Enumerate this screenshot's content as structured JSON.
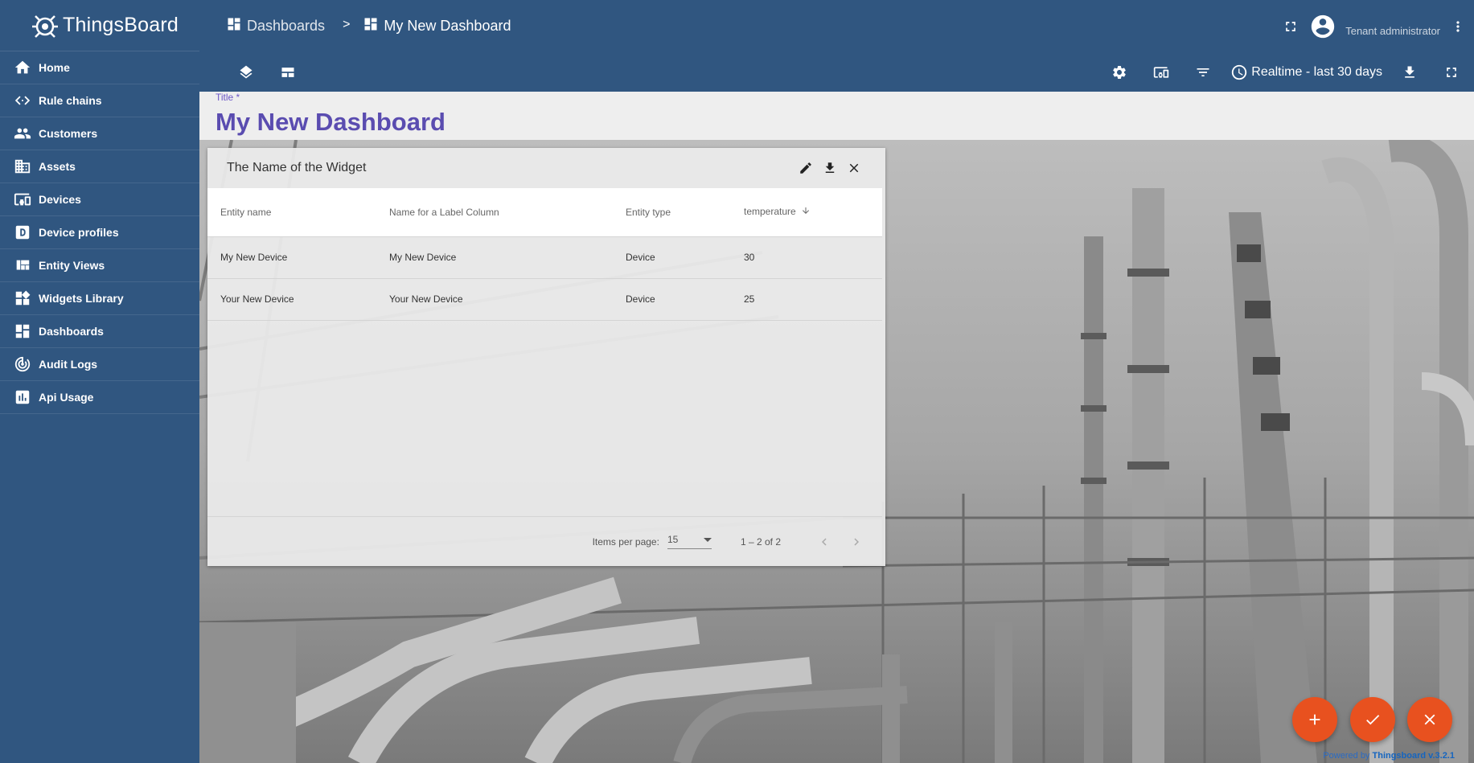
{
  "app": {
    "name": "ThingsBoard"
  },
  "sidebar": {
    "items": [
      {
        "label": "Home",
        "icon": "home-icon"
      },
      {
        "label": "Rule chains",
        "icon": "code-arrows-icon"
      },
      {
        "label": "Customers",
        "icon": "people-icon"
      },
      {
        "label": "Assets",
        "icon": "building-icon"
      },
      {
        "label": "Devices",
        "icon": "devices-icon"
      },
      {
        "label": "Device profiles",
        "icon": "device-profile-icon"
      },
      {
        "label": "Entity Views",
        "icon": "view-quilt-icon"
      },
      {
        "label": "Widgets Library",
        "icon": "widgets-icon"
      },
      {
        "label": "Dashboards",
        "icon": "dashboard-icon"
      },
      {
        "label": "Audit Logs",
        "icon": "track-changes-icon"
      },
      {
        "label": "Api Usage",
        "icon": "insert-chart-icon"
      }
    ]
  },
  "header": {
    "breadcrumb": [
      {
        "label": "Dashboards"
      },
      {
        "label": "My New Dashboard"
      }
    ],
    "separator": ">",
    "user_role": "Tenant administrator",
    "timewindow": "Realtime - last 30 days"
  },
  "dashboard": {
    "title_label": "Title *",
    "title_value": "My New Dashboard"
  },
  "widget": {
    "title": "The Name of the Widget",
    "columns": [
      "Entity name",
      "Name for a Label Column",
      "Entity type",
      "temperature"
    ],
    "rows": [
      [
        "My New Device",
        "My New Device",
        "Device",
        "30"
      ],
      [
        "Your New Device",
        "Your New Device",
        "Device",
        "25"
      ]
    ],
    "paginator": {
      "items_per_page_label": "Items per page:",
      "items_per_page_value": "15",
      "range": "1 – 2 of 2"
    }
  },
  "footer": {
    "powered_prefix": "Powered by",
    "powered_brand": "Thingsboard v.3.2.1"
  },
  "colors": {
    "primary": "#305680",
    "accent_fab": "#e8511f",
    "title_text": "#5a4cb0"
  }
}
